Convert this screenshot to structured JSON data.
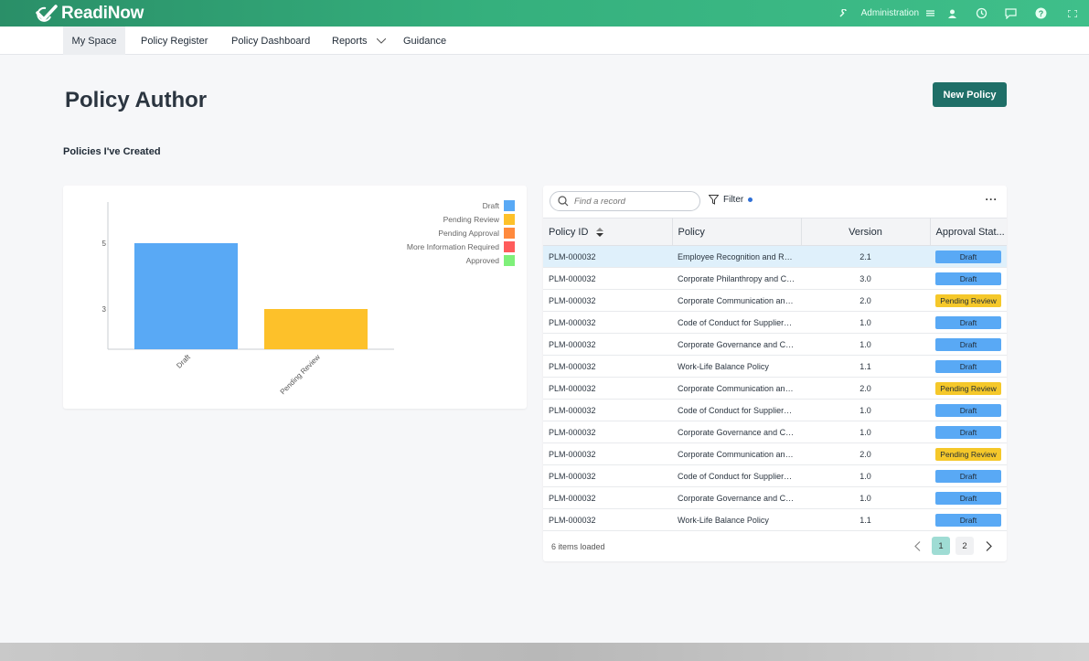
{
  "app": {
    "logo_text": "ReadiNow",
    "brand_color": "#35b07d"
  },
  "topbar": {
    "admin_label": "Administration"
  },
  "nav": {
    "items": [
      {
        "label": "My Space"
      },
      {
        "label": "Policy Register"
      },
      {
        "label": "Policy Dashboard"
      },
      {
        "label": "Reports"
      },
      {
        "label": "Guidance"
      }
    ]
  },
  "page": {
    "title": "Policy Author",
    "new_button": "New Policy",
    "section_title": "Policies I've Created"
  },
  "chart_data": {
    "type": "bar",
    "categories": [
      "Draft",
      "Pending Review"
    ],
    "values": [
      5,
      3
    ],
    "colors": [
      "#59a9f5",
      "#fdc12a"
    ],
    "yticks": [
      3,
      5
    ],
    "legend": [
      {
        "label": "Draft",
        "color": "#59a9f5"
      },
      {
        "label": "Pending Review",
        "color": "#fdc12a"
      },
      {
        "label": "Pending Approval",
        "color": "#ff8a3d"
      },
      {
        "label": "More Information Required",
        "color": "#ff5c5c"
      },
      {
        "label": "Approved",
        "color": "#7ff07a"
      }
    ],
    "legend_position": "top-right"
  },
  "table": {
    "search_placeholder": "Find a record",
    "filter_label": "Filter",
    "columns": [
      "Policy ID",
      "Policy",
      "Version",
      "Approval Stat..."
    ],
    "rows": [
      {
        "id": "PLM-000032",
        "policy": "Employee Recognition and Re...",
        "version": "2.1",
        "status": "Draft"
      },
      {
        "id": "PLM-000032",
        "policy": "Corporate Philanthropy and Co...",
        "version": "3.0",
        "status": "Draft"
      },
      {
        "id": "PLM-000032",
        "policy": "Corporate Communication and...",
        "version": "2.0",
        "status": "Pending Review"
      },
      {
        "id": "PLM-000032",
        "policy": "Code of Conduct for Suppliers ...",
        "version": "1.0",
        "status": "Draft"
      },
      {
        "id": "PLM-000032",
        "policy": "Corporate Governance and Co...",
        "version": "1.0",
        "status": "Draft"
      },
      {
        "id": "PLM-000032",
        "policy": "Work-Life Balance Policy",
        "version": "1.1",
        "status": "Draft"
      },
      {
        "id": "PLM-000032",
        "policy": "Corporate Communication and...",
        "version": "2.0",
        "status": "Pending Review"
      },
      {
        "id": "PLM-000032",
        "policy": "Code of Conduct for Suppliers ...",
        "version": "1.0",
        "status": "Draft"
      },
      {
        "id": "PLM-000032",
        "policy": "Corporate Governance and Co...",
        "version": "1.0",
        "status": "Draft"
      },
      {
        "id": "PLM-000032",
        "policy": "Corporate Communication and...",
        "version": "2.0",
        "status": "Pending Review"
      },
      {
        "id": "PLM-000032",
        "policy": "Code of Conduct for Suppliers ...",
        "version": "1.0",
        "status": "Draft"
      },
      {
        "id": "PLM-000032",
        "policy": "Corporate Governance and Co...",
        "version": "1.0",
        "status": "Draft"
      },
      {
        "id": "PLM-000032",
        "policy": "Work-Life Balance Policy",
        "version": "1.1",
        "status": "Draft"
      }
    ],
    "footer_text": "6 items loaded",
    "pages": [
      "1",
      "2"
    ],
    "current_page": "1"
  }
}
